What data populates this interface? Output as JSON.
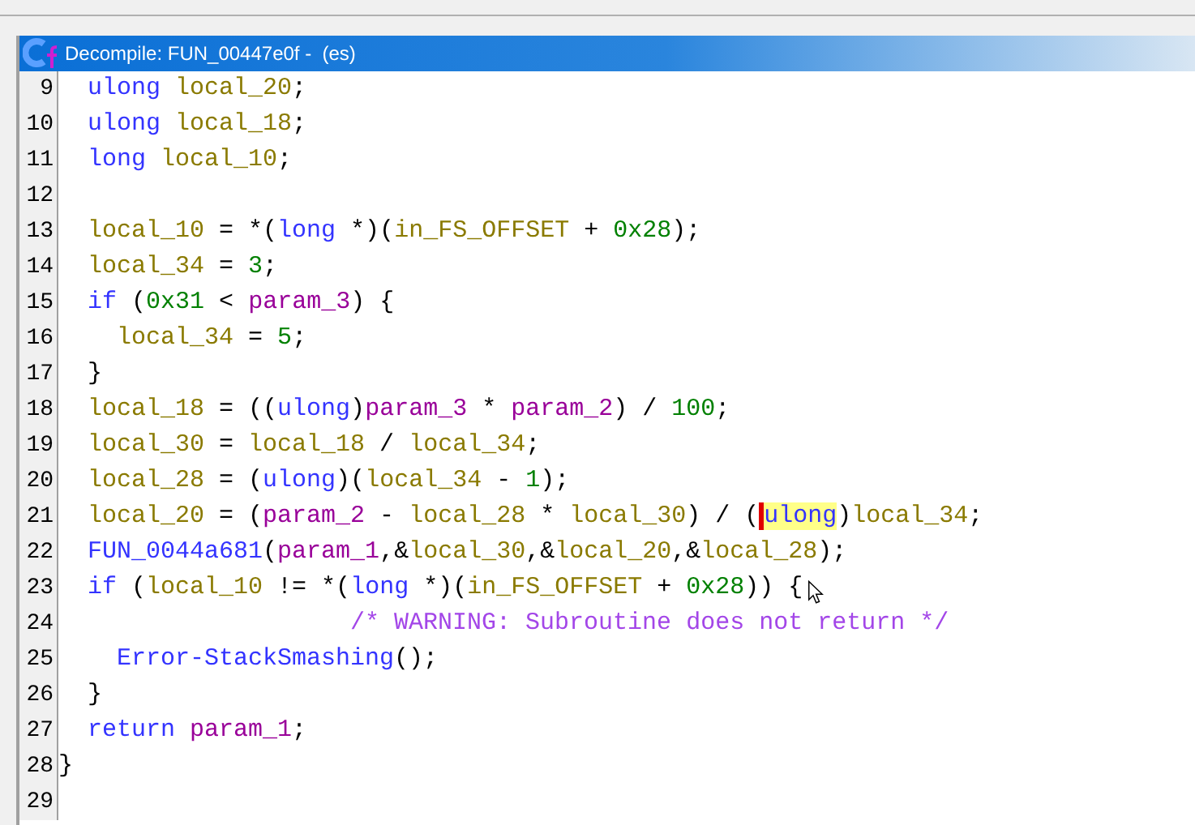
{
  "window": {
    "title": "Decompile: FUN_00447e0f -  (es)"
  },
  "lines": [
    {
      "number": "9",
      "tokens": [
        {
          "text": "  ulong",
          "kind": "type"
        },
        {
          "text": " local_20",
          "kind": "var"
        },
        {
          "text": ";",
          "kind": "plain"
        }
      ]
    },
    {
      "number": "10",
      "tokens": [
        {
          "text": "  ulong",
          "kind": "type"
        },
        {
          "text": " local_18",
          "kind": "var"
        },
        {
          "text": ";",
          "kind": "plain"
        }
      ]
    },
    {
      "number": "11",
      "tokens": [
        {
          "text": "  long",
          "kind": "type"
        },
        {
          "text": " local_10",
          "kind": "var"
        },
        {
          "text": ";",
          "kind": "plain"
        }
      ]
    },
    {
      "number": "12"
    },
    {
      "number": "13",
      "tokens": [
        {
          "text": "  local_10",
          "kind": "var"
        },
        {
          "text": " = *(",
          "kind": "plain"
        },
        {
          "text": "long",
          "kind": "type"
        },
        {
          "text": " *)(",
          "kind": "plain"
        },
        {
          "text": "in_FS_OFFSET",
          "kind": "var"
        },
        {
          "text": " + ",
          "kind": "plain"
        },
        {
          "text": "0x28",
          "kind": "number"
        },
        {
          "text": ");",
          "kind": "plain"
        }
      ]
    },
    {
      "number": "14",
      "tokens": [
        {
          "text": "  local_34",
          "kind": "var"
        },
        {
          "text": " = ",
          "kind": "plain"
        },
        {
          "text": "3",
          "kind": "number"
        },
        {
          "text": ";",
          "kind": "plain"
        }
      ]
    },
    {
      "number": "15",
      "tokens": [
        {
          "text": "  if",
          "kind": "keyword"
        },
        {
          "text": " (",
          "kind": "plain"
        },
        {
          "text": "0x31",
          "kind": "number"
        },
        {
          "text": " < ",
          "kind": "plain"
        },
        {
          "text": "param_3",
          "kind": "param"
        },
        {
          "text": ") {",
          "kind": "plain"
        }
      ]
    },
    {
      "number": "16",
      "tokens": [
        {
          "text": "    local_34",
          "kind": "var"
        },
        {
          "text": " = ",
          "kind": "plain"
        },
        {
          "text": "5",
          "kind": "number"
        },
        {
          "text": ";",
          "kind": "plain"
        }
      ]
    },
    {
      "number": "17",
      "tokens": [
        {
          "text": "  }",
          "kind": "plain"
        }
      ]
    },
    {
      "number": "18",
      "tokens": [
        {
          "text": "  local_18",
          "kind": "var"
        },
        {
          "text": " = ((",
          "kind": "plain"
        },
        {
          "text": "ulong",
          "kind": "type"
        },
        {
          "text": ")",
          "kind": "plain"
        },
        {
          "text": "param_3",
          "kind": "param"
        },
        {
          "text": " * ",
          "kind": "plain"
        },
        {
          "text": "param_2",
          "kind": "param"
        },
        {
          "text": ") / ",
          "kind": "plain"
        },
        {
          "text": "100",
          "kind": "number"
        },
        {
          "text": ";",
          "kind": "plain"
        }
      ]
    },
    {
      "number": "19",
      "tokens": [
        {
          "text": "  local_30",
          "kind": "var"
        },
        {
          "text": " = ",
          "kind": "plain"
        },
        {
          "text": "local_18",
          "kind": "var"
        },
        {
          "text": " / ",
          "kind": "plain"
        },
        {
          "text": "local_34",
          "kind": "var"
        },
        {
          "text": ";",
          "kind": "plain"
        }
      ]
    },
    {
      "number": "20",
      "tokens": [
        {
          "text": "  local_28",
          "kind": "var"
        },
        {
          "text": " = (",
          "kind": "plain"
        },
        {
          "text": "ulong",
          "kind": "type"
        },
        {
          "text": ")(",
          "kind": "plain"
        },
        {
          "text": "local_34",
          "kind": "var"
        },
        {
          "text": " - ",
          "kind": "plain"
        },
        {
          "text": "1",
          "kind": "number"
        },
        {
          "text": ");",
          "kind": "plain"
        }
      ]
    },
    {
      "number": "21",
      "tokens": [
        {
          "text": "  local_20",
          "kind": "var"
        },
        {
          "text": " = (",
          "kind": "plain"
        },
        {
          "text": "param_2",
          "kind": "param"
        },
        {
          "text": " - ",
          "kind": "plain"
        },
        {
          "text": "local_28",
          "kind": "var"
        },
        {
          "text": " * ",
          "kind": "plain"
        },
        {
          "text": "local_30",
          "kind": "var"
        },
        {
          "text": ") / (",
          "kind": "plain"
        },
        {
          "text": "ulong",
          "kind": "type",
          "highlighted": true,
          "caret": true
        },
        {
          "text": ")",
          "kind": "plain"
        },
        {
          "text": "local_34",
          "kind": "var"
        },
        {
          "text": ";",
          "kind": "plain"
        }
      ]
    },
    {
      "number": "22",
      "tokens": [
        {
          "text": "  FUN_0044a681",
          "kind": "func"
        },
        {
          "text": "(",
          "kind": "plain"
        },
        {
          "text": "param_1",
          "kind": "param"
        },
        {
          "text": ",&",
          "kind": "plain"
        },
        {
          "text": "local_30",
          "kind": "var"
        },
        {
          "text": ",&",
          "kind": "plain"
        },
        {
          "text": "local_20",
          "kind": "var"
        },
        {
          "text": ",&",
          "kind": "plain"
        },
        {
          "text": "local_28",
          "kind": "var"
        },
        {
          "text": ");",
          "kind": "plain"
        }
      ]
    },
    {
      "number": "23",
      "tokens": [
        {
          "text": "  if",
          "kind": "keyword"
        },
        {
          "text": " (",
          "kind": "plain"
        },
        {
          "text": "local_10",
          "kind": "var"
        },
        {
          "text": " != *(",
          "kind": "plain"
        },
        {
          "text": "long",
          "kind": "type"
        },
        {
          "text": " *)(",
          "kind": "plain"
        },
        {
          "text": "in_FS_OFFSET",
          "kind": "var"
        },
        {
          "text": " + ",
          "kind": "plain"
        },
        {
          "text": "0x28",
          "kind": "number"
        },
        {
          "text": ")) {",
          "kind": "plain"
        }
      ]
    },
    {
      "number": "24",
      "tokens": [
        {
          "text": "                    /* WARNING: Subroutine does not return */",
          "kind": "comment"
        }
      ]
    },
    {
      "number": "25",
      "tokens": [
        {
          "text": "    Error-StackSmashing",
          "kind": "func"
        },
        {
          "text": "();",
          "kind": "plain"
        }
      ]
    },
    {
      "number": "26",
      "tokens": [
        {
          "text": "  }",
          "kind": "plain"
        }
      ]
    },
    {
      "number": "27",
      "tokens": [
        {
          "text": "  return",
          "kind": "keyword"
        },
        {
          "text": " param_1",
          "kind": "param"
        },
        {
          "text": ";",
          "kind": "plain"
        }
      ]
    },
    {
      "number": "28",
      "tokens": [
        {
          "text": "}",
          "kind": "plain"
        }
      ]
    },
    {
      "number": "29"
    }
  ]
}
